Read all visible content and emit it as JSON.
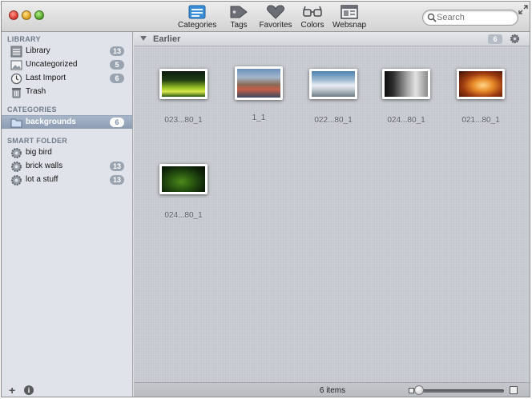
{
  "toolbar": {
    "tabs": [
      {
        "label": "Categories",
        "icon": "categories-icon",
        "active": true
      },
      {
        "label": "Tags",
        "icon": "tag-icon"
      },
      {
        "label": "Favorites",
        "icon": "heart-icon"
      },
      {
        "label": "Colors",
        "icon": "glasses-icon"
      },
      {
        "label": "Websnap",
        "icon": "websnap-icon"
      }
    ],
    "search": {
      "placeholder": "Search",
      "value": ""
    }
  },
  "sidebar": {
    "library_header": "LIBRARY",
    "library_items": [
      {
        "label": "Library",
        "count": "13",
        "icon": "library-icon"
      },
      {
        "label": "Uncategorized",
        "count": "5",
        "icon": "uncategorized-icon"
      },
      {
        "label": "Last Import",
        "count": "6",
        "icon": "clock-icon"
      },
      {
        "label": "Trash",
        "icon": "trash-icon"
      }
    ],
    "categories_header": "CATEGORIES",
    "category_items": [
      {
        "label": "backgrounds",
        "count": "6",
        "icon": "folder-icon",
        "selected": true
      }
    ],
    "smart_header": "SMART FOLDER",
    "smart_items": [
      {
        "label": "big bird",
        "icon": "gear-icon"
      },
      {
        "label": "brick walls",
        "count": "13",
        "icon": "gear-icon"
      },
      {
        "label": "lot a stuff",
        "count": "13",
        "icon": "gear-icon"
      }
    ],
    "add_symbol": "+",
    "info_symbol": "i"
  },
  "main": {
    "group": {
      "title": "Earlier",
      "count": "6"
    },
    "thumbnails": [
      {
        "caption": "023...80_1"
      },
      {
        "caption": "1_1"
      },
      {
        "caption": "022...80_1"
      },
      {
        "caption": "024...80_1"
      },
      {
        "caption": "021...80_1"
      },
      {
        "caption": "024...80_1"
      }
    ]
  },
  "status": {
    "items_text": "6 items"
  },
  "colors": {
    "accent": "#3b8fd9",
    "selection": "#8b9bb1",
    "count_badge": "#9aa4b0"
  }
}
